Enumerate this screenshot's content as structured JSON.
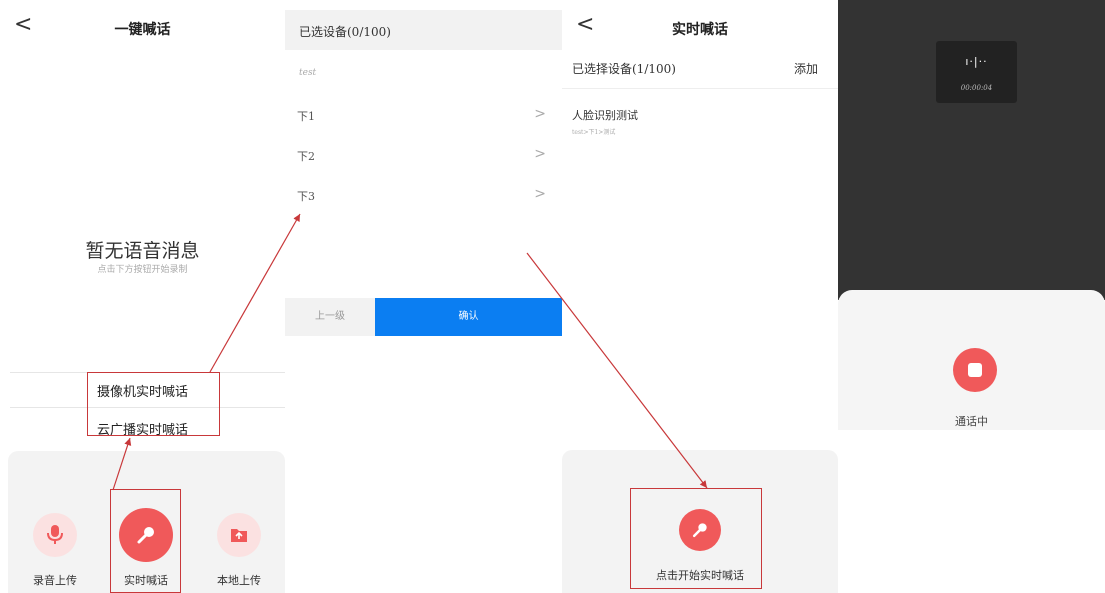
{
  "panel1": {
    "back_glyph": "<",
    "title": "一键喊话",
    "empty_title": "暂无语音消息",
    "empty_hint": "点击下方按钮开始录制",
    "option_camera": "摄像机实时喊话",
    "option_cloud": "云广播实时喊话",
    "btn_record": "录音上传",
    "btn_live": "实时喊话",
    "btn_local": "本地上传",
    "icons": {
      "record": "microphone-icon",
      "live": "microphone-icon",
      "local": "folder-upload-icon"
    }
  },
  "panel2": {
    "header": "已选设备(0/100)",
    "group": "test",
    "rows": [
      {
        "label": "下1",
        "chevron": ">"
      },
      {
        "label": "下2",
        "chevron": ">"
      },
      {
        "label": "下3",
        "chevron": ">"
      }
    ],
    "btn_prev": "上一级",
    "btn_confirm": "确认"
  },
  "panel3": {
    "back_glyph": "<",
    "title": "实时喊话",
    "selected": "已选择设备(1/100)",
    "add": "添加",
    "device_name": "人脸识别测试",
    "device_path": "test>下1>测试",
    "start_label": "点击开始实时喊话"
  },
  "panel4": {
    "wave": "ı·|··",
    "timer": "00:00:04",
    "status": "通话中",
    "icons": {
      "stop": "stop-icon"
    }
  },
  "colors": {
    "accent_red": "#f0595a",
    "accent_blue": "#0b7ef2",
    "annotation": "#c8383a"
  }
}
